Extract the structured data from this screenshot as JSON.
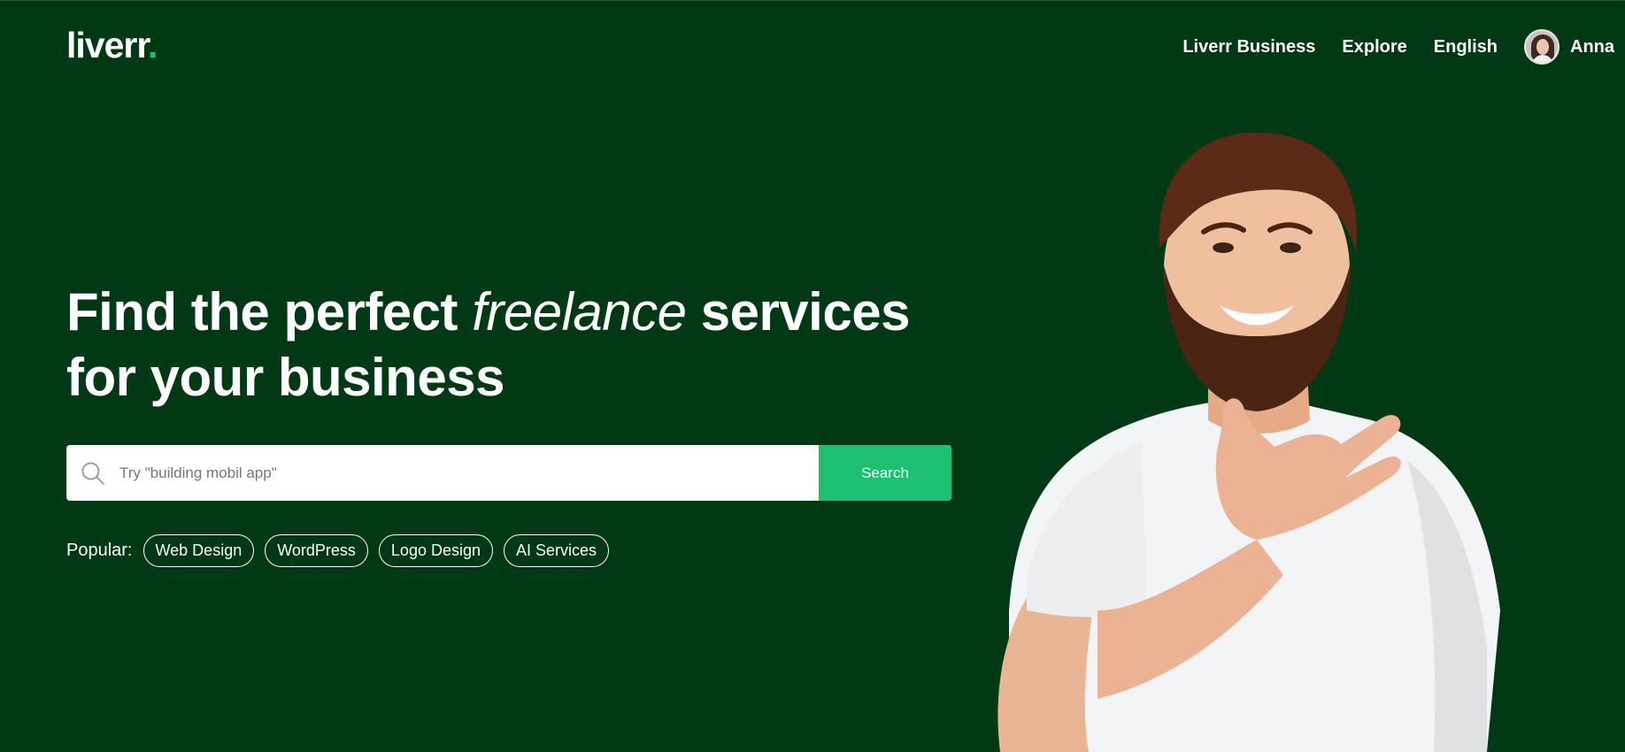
{
  "brand": {
    "name": "liverr",
    "dot": ".",
    "accent_color": "#1dbf73",
    "background_color": "#013914"
  },
  "nav": {
    "items": [
      {
        "label": "Liverr Business"
      },
      {
        "label": "Explore"
      },
      {
        "label": "English"
      }
    ],
    "user": {
      "name": "Anna",
      "avatar": "user-avatar"
    }
  },
  "hero": {
    "headline_part1": "Find the perfect ",
    "headline_italic": "freelance",
    "headline_part2": " services",
    "headline_line2": "for your business",
    "illustration": "smiling-man-in-white-tshirt"
  },
  "search": {
    "placeholder": "Try \"building mobil app\"",
    "value": "",
    "button_label": "Search",
    "icon": "search-icon"
  },
  "popular": {
    "label": "Popular:",
    "tags": [
      {
        "label": "Web Design"
      },
      {
        "label": "WordPress"
      },
      {
        "label": "Logo Design"
      },
      {
        "label": "AI Services"
      }
    ]
  }
}
